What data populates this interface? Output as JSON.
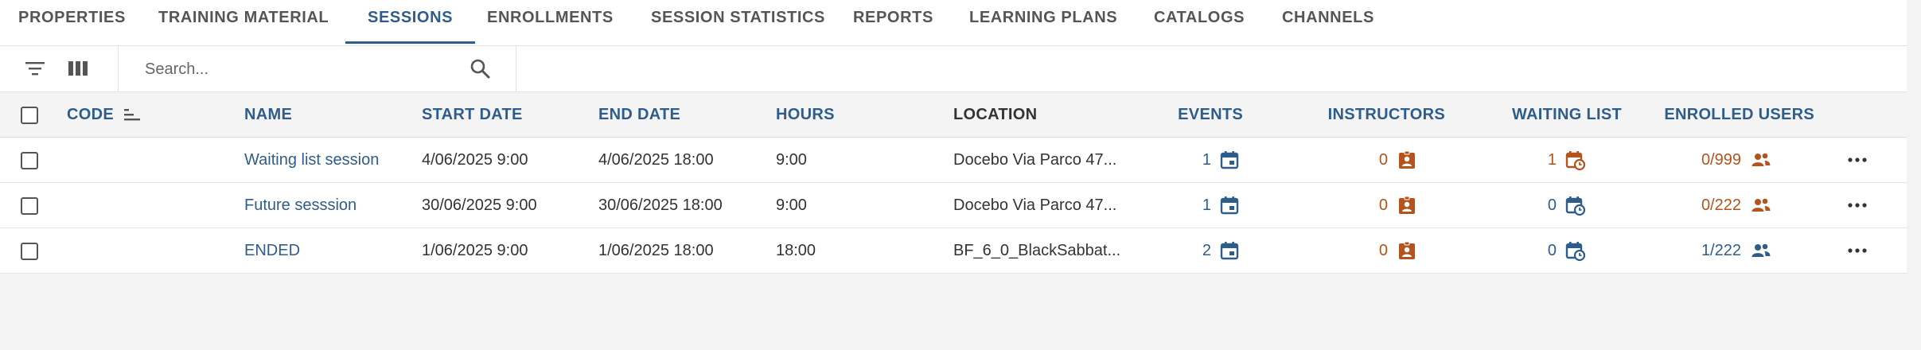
{
  "tabs": [
    {
      "label": "PROPERTIES",
      "active": false
    },
    {
      "label": "TRAINING MATERIAL",
      "active": false
    },
    {
      "label": "SESSIONS",
      "active": true
    },
    {
      "label": "ENROLLMENTS",
      "active": false
    },
    {
      "label": "SESSION STATISTICS",
      "active": false
    },
    {
      "label": "REPORTS",
      "active": false
    },
    {
      "label": "LEARNING PLANS",
      "active": false
    },
    {
      "label": "CATALOGS",
      "active": false
    },
    {
      "label": "CHANNELS",
      "active": false
    }
  ],
  "toolbar": {
    "filter_icon": "filter-icon",
    "columns_icon": "columns-icon",
    "search_placeholder": "Search...",
    "search_icon": "search-icon"
  },
  "table": {
    "headers": {
      "code": "CODE",
      "name": "NAME",
      "start_date": "START DATE",
      "end_date": "END DATE",
      "hours": "HOURS",
      "location": "LOCATION",
      "events": "EVENTS",
      "instructors": "INSTRUCTORS",
      "waiting_list": "WAITING LIST",
      "enrolled_users": "ENROLLED USERS"
    },
    "rows": [
      {
        "code": "",
        "name": "Waiting list session",
        "start_date": "4/06/2025 9:00",
        "end_date": "4/06/2025 18:00",
        "hours": "9:00",
        "location": "Docebo Via Parco 47...",
        "events": "1",
        "instructors": "0",
        "waiting_list": "1",
        "waiting_highlight": true,
        "enrolled_users": "0/999",
        "enrolled_highlight": true
      },
      {
        "code": "",
        "name": "Future sesssion",
        "start_date": "30/06/2025 9:00",
        "end_date": "30/06/2025 18:00",
        "hours": "9:00",
        "location": "Docebo Via Parco 47...",
        "events": "1",
        "instructors": "0",
        "waiting_list": "0",
        "waiting_highlight": false,
        "enrolled_users": "0/222",
        "enrolled_highlight": true
      },
      {
        "code": "",
        "name": "ENDED",
        "start_date": "1/06/2025 9:00",
        "end_date": "1/06/2025 18:00",
        "hours": "18:00",
        "location": "BF_6_0_BlackSabbat...",
        "events": "2",
        "instructors": "0",
        "waiting_list": "0",
        "waiting_highlight": false,
        "enrolled_users": "1/222",
        "enrolled_highlight": false
      }
    ]
  },
  "colors": {
    "accent": "#2f5d8a",
    "warning": "#b5531c",
    "header_bg": "#f4f4f4",
    "page_bg": "#f3f3f3"
  }
}
